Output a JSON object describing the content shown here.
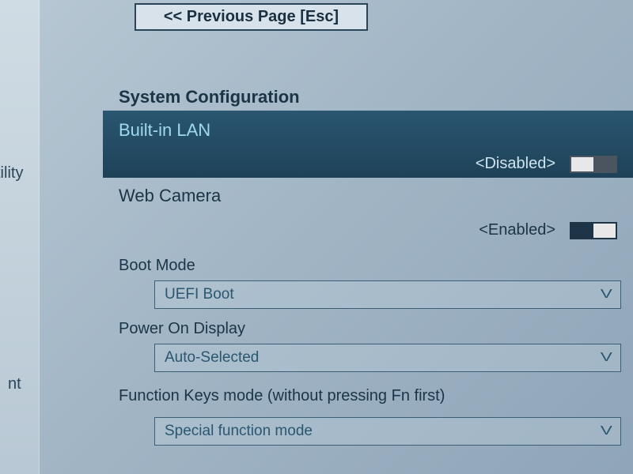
{
  "nav": {
    "prev_label": "<< Previous Page [Esc]"
  },
  "sidebar": {
    "utility_fragment": "tility",
    "nt_fragment": "nt"
  },
  "section": {
    "title": "System Configuration"
  },
  "lan": {
    "label": "Built-in LAN",
    "value": "<Disabled>"
  },
  "webcam": {
    "label": "Web Camera",
    "value": "<Enabled>"
  },
  "bootmode": {
    "label": "Boot Mode",
    "value": "UEFI Boot"
  },
  "power": {
    "label": "Power On Display",
    "value": "Auto-Selected"
  },
  "fnkeys": {
    "label": "Function Keys mode (without pressing Fn first)",
    "value": "Special function mode"
  }
}
